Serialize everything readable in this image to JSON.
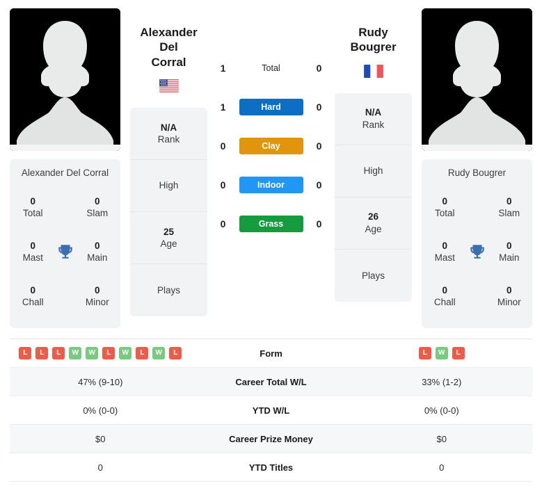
{
  "players": {
    "left": {
      "name_line1": "Alexander Del",
      "name_line2": "Corral",
      "full_name": "Alexander Del Corral",
      "country_flag": "us-flag",
      "avatar": "player-silhouette-avatar",
      "titles": {
        "total": "0",
        "total_label": "Total",
        "slam": "0",
        "slam_label": "Slam",
        "mast": "0",
        "mast_label": "Mast",
        "main": "0",
        "main_label": "Main",
        "chall": "0",
        "chall_label": "Chall",
        "minor": "0",
        "minor_label": "Minor"
      },
      "info": {
        "rank_value": "N/A",
        "rank_label": "Rank",
        "high_value": "",
        "high_label": "High",
        "age_value": "25",
        "age_label": "Age",
        "plays_value": "",
        "plays_label": "Plays"
      },
      "form": [
        "L",
        "L",
        "L",
        "W",
        "W",
        "L",
        "W",
        "L",
        "W",
        "L"
      ],
      "career_wl": "47% (9-10)",
      "ytd_wl": "0% (0-0)",
      "career_prize": "$0",
      "ytd_titles": "0"
    },
    "right": {
      "name_line1": "Rudy",
      "name_line2": "Bougrer",
      "full_name": "Rudy Bougrer",
      "country_flag": "fr-flag",
      "avatar": "player-silhouette-avatar",
      "titles": {
        "total": "0",
        "total_label": "Total",
        "slam": "0",
        "slam_label": "Slam",
        "mast": "0",
        "mast_label": "Mast",
        "main": "0",
        "main_label": "Main",
        "chall": "0",
        "chall_label": "Chall",
        "minor": "0",
        "minor_label": "Minor"
      },
      "info": {
        "rank_value": "N/A",
        "rank_label": "Rank",
        "high_value": "",
        "high_label": "High",
        "age_value": "26",
        "age_label": "Age",
        "plays_value": "",
        "plays_label": "Plays"
      },
      "form": [
        "L",
        "W",
        "L"
      ],
      "career_wl": "33% (1-2)",
      "ytd_wl": "0% (0-0)",
      "career_prize": "$0",
      "ytd_titles": "0"
    }
  },
  "h2h_surfaces": [
    {
      "label": "Total",
      "left": "1",
      "right": "0",
      "color": "",
      "style": "plain"
    },
    {
      "label": "Hard",
      "left": "1",
      "right": "0",
      "color": "#0d6fc4",
      "style": "bar"
    },
    {
      "label": "Clay",
      "left": "0",
      "right": "0",
      "color": "#e2940c",
      "style": "bar"
    },
    {
      "label": "Indoor",
      "left": "0",
      "right": "0",
      "color": "#2196f3",
      "style": "bar"
    },
    {
      "label": "Grass",
      "left": "0",
      "right": "0",
      "color": "#169b3e",
      "style": "bar"
    }
  ],
  "comparison_rows": [
    {
      "label": "Form",
      "type": "form"
    },
    {
      "label": "Career Total W/L",
      "type": "text",
      "key": "career_wl"
    },
    {
      "label": "YTD W/L",
      "type": "text",
      "key": "ytd_wl"
    },
    {
      "label": "Career Prize Money",
      "type": "text",
      "key": "career_prize"
    },
    {
      "label": "YTD Titles",
      "type": "text",
      "key": "ytd_titles"
    }
  ],
  "colors": {
    "win_badge": "#79c97f",
    "loss_badge": "#ee5b48",
    "card_bg": "#f1f3f4",
    "trophy": "#3b6fb0"
  }
}
